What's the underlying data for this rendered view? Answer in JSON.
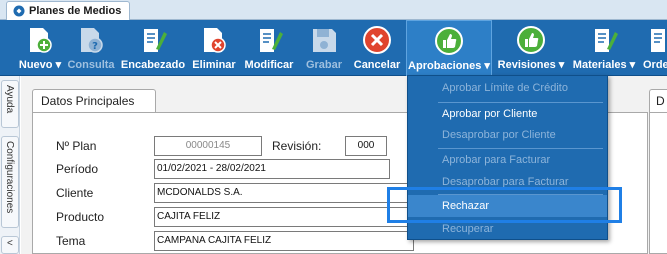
{
  "window_tab": {
    "title": "Planes de Medios"
  },
  "toolbar": {
    "buttons": [
      {
        "label": "Nuevo ▾",
        "icon": "new-document-icon"
      },
      {
        "label": "Consulta",
        "icon": "query-document-icon"
      },
      {
        "label": "Encabezado",
        "icon": "edit-header-icon"
      },
      {
        "label": "Eliminar",
        "icon": "delete-document-icon"
      },
      {
        "label": "Modificar",
        "icon": "modify-document-icon"
      },
      {
        "label": "Grabar",
        "icon": "save-disk-icon"
      },
      {
        "label": "Cancelar",
        "icon": "cancel-icon"
      },
      {
        "label": "Aprobaciones ▾",
        "icon": "thumbs-up-icon"
      },
      {
        "label": "Revisiones ▾",
        "icon": "thumbs-up-icon"
      },
      {
        "label": "Materiales ▾",
        "icon": "materials-icon"
      },
      {
        "label": "Orde",
        "icon": "orders-icon"
      }
    ]
  },
  "side_tabs": {
    "ayuda": "Ayuda",
    "configuraciones": "Configuraciones",
    "more": "<"
  },
  "panel": {
    "tab_title": "Datos Principales",
    "right_tab_title": "D"
  },
  "form": {
    "plan_label": "Nº Plan",
    "plan_value": "00000145",
    "revision_label": "Revisión:",
    "revision_value": "000",
    "periodo_label": "Período",
    "periodo_value": "01/02/2021 - 28/02/2021",
    "cliente_label": "Cliente",
    "cliente_value": "MCDONALDS S.A.",
    "producto_label": "Producto",
    "producto_value": "CAJITA FELIZ",
    "tema_label": "Tema",
    "tema_value": "CAMPANA CAJITA FELIZ"
  },
  "menu": {
    "items": [
      {
        "label": "Aprobar Límite de Crédito",
        "enabled": false
      },
      {
        "label": "Aprobar por Cliente",
        "enabled": true
      },
      {
        "label": "Desaprobar por Cliente",
        "enabled": false
      },
      {
        "label": "Aprobar para Facturar",
        "enabled": false
      },
      {
        "label": "Desaprobar para Facturar",
        "enabled": false
      },
      {
        "label": "Rechazar",
        "enabled": true
      },
      {
        "label": "Recuperar",
        "enabled": false
      }
    ]
  },
  "colors": {
    "toolbar": "#1f6bb0",
    "menu": "#1f6bb0",
    "highlight": "#1f7fe6",
    "green_icon": "#4caf3a",
    "cancel_icon": "#e0442e"
  }
}
